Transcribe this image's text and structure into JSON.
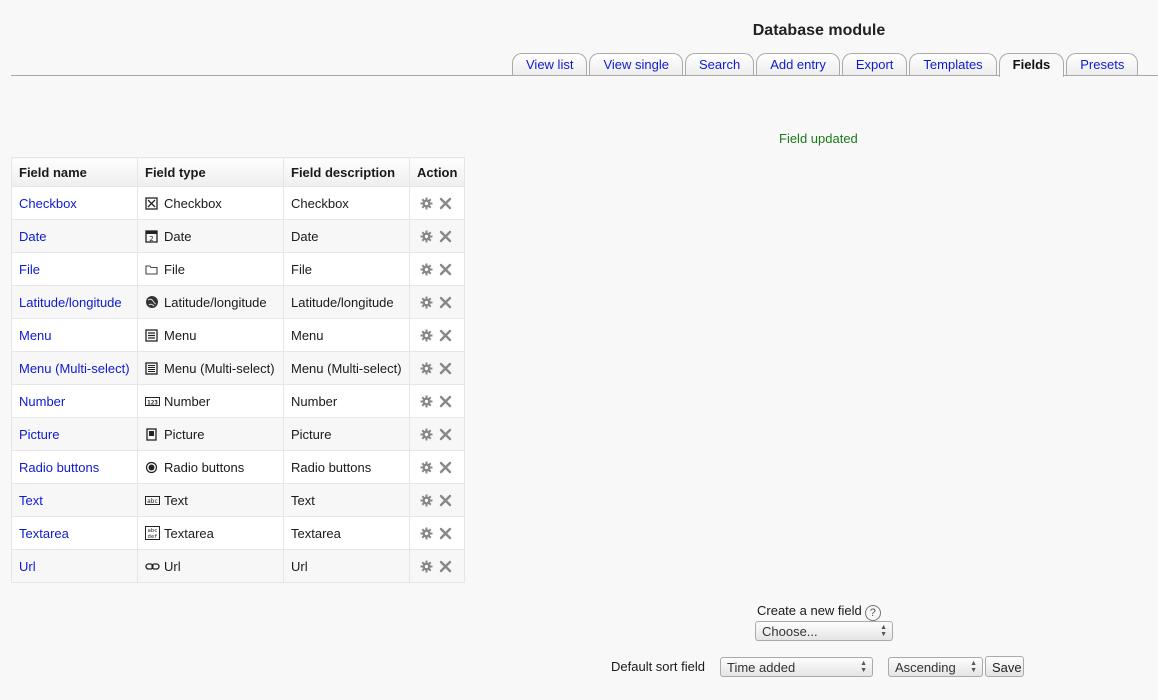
{
  "page": {
    "title": "Database module"
  },
  "tabs": [
    {
      "label": "View list",
      "active": false
    },
    {
      "label": "View single",
      "active": false
    },
    {
      "label": "Search",
      "active": false
    },
    {
      "label": "Add entry",
      "active": false
    },
    {
      "label": "Export",
      "active": false
    },
    {
      "label": "Templates",
      "active": false
    },
    {
      "label": "Fields",
      "active": true
    },
    {
      "label": "Presets",
      "active": false
    }
  ],
  "notice": "Field updated",
  "table": {
    "headers": [
      "Field name",
      "Field type",
      "Field description",
      "Action"
    ],
    "rows": [
      {
        "name": "Checkbox",
        "type": "Checkbox",
        "icon": "checkbox-icon",
        "description": "Checkbox"
      },
      {
        "name": "Date",
        "type": "Date",
        "icon": "date-icon",
        "description": "Date"
      },
      {
        "name": "File",
        "type": "File",
        "icon": "folder-icon",
        "description": "File"
      },
      {
        "name": "Latitude/longitude",
        "type": "Latitude/longitude",
        "icon": "globe-icon",
        "description": "Latitude/longitude"
      },
      {
        "name": "Menu",
        "type": "Menu",
        "icon": "menu-icon",
        "description": "Menu"
      },
      {
        "name": "Menu (Multi-select)",
        "type": "Menu (Multi-select)",
        "icon": "multimenu-icon",
        "description": "Menu (Multi-select)"
      },
      {
        "name": "Number",
        "type": "Number",
        "icon": "number-icon",
        "description": "Number"
      },
      {
        "name": "Picture",
        "type": "Picture",
        "icon": "picture-icon",
        "description": "Picture"
      },
      {
        "name": "Radio buttons",
        "type": "Radio buttons",
        "icon": "radio-icon",
        "description": "Radio buttons"
      },
      {
        "name": "Text",
        "type": "Text",
        "icon": "text-icon",
        "description": "Text"
      },
      {
        "name": "Textarea",
        "type": "Textarea",
        "icon": "textarea-icon",
        "description": "Textarea"
      },
      {
        "name": "Url",
        "type": "Url",
        "icon": "link-icon",
        "description": "Url"
      }
    ]
  },
  "create_field": {
    "label": "Create a new field",
    "selected": "Choose..."
  },
  "sort": {
    "label": "Default sort field",
    "field_selected": "Time added",
    "order_selected": "Ascending",
    "save_label": "Save"
  },
  "colors": {
    "link": "#0d1ad1",
    "notice": "#1a7a1a"
  }
}
